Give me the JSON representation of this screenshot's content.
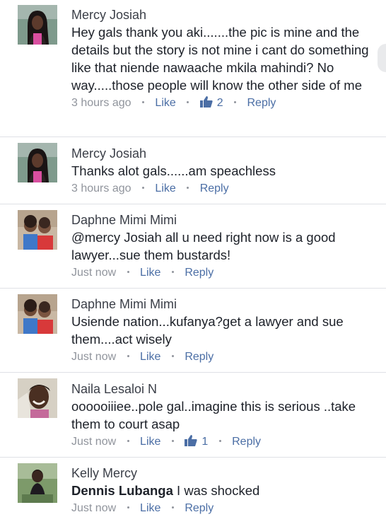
{
  "comments": [
    {
      "author": "Mercy Josiah",
      "mention": "",
      "text": "Hey gals thank you aki.......the pic is mine and the details but the story is not mine i cant do something like that niende nawaache mkila mahindi? No way.....those people will know the other side of me",
      "time": "3 hours ago",
      "like": "Like",
      "likes": "2",
      "reply": "Reply",
      "avatar": "woman-dark-hair"
    },
    {
      "author": "Mercy Josiah",
      "mention": "",
      "text": "Thanks alot gals......am speachless",
      "time": "3 hours ago",
      "like": "Like",
      "likes": "",
      "reply": "Reply",
      "avatar": "woman-dark-hair"
    },
    {
      "author": "Daphne Mimi Mimi",
      "mention": "",
      "text": "@mercy Josiah all u need right now is a good lawyer...sue them bustards!",
      "time": "Just now",
      "like": "Like",
      "likes": "",
      "reply": "Reply",
      "avatar": "two-children"
    },
    {
      "author": "Daphne Mimi Mimi",
      "mention": "",
      "text": "Usiende nation...kufanya?get a lawyer and sue them....act wisely",
      "time": "Just now",
      "like": "Like",
      "likes": "",
      "reply": "Reply",
      "avatar": "two-children"
    },
    {
      "author": "Naila Lesaloi N",
      "mention": "",
      "text": "oooooiiiee..pole gal..imagine this is serious ..take them to court asap",
      "time": "Just now",
      "like": "Like",
      "likes": "1",
      "reply": "Reply",
      "avatar": "smiling-girl"
    },
    {
      "author": "Kelly Mercy",
      "mention": "Dennis Lubanga",
      "text": "I was shocked",
      "time": "Just now",
      "like": "Like",
      "likes": "",
      "reply": "Reply",
      "avatar": "woman-outdoors"
    }
  ],
  "colors": {
    "link": "#4b6ea5",
    "meta": "#90949c",
    "text": "#1d2129",
    "separator": "#dfe1e6"
  }
}
